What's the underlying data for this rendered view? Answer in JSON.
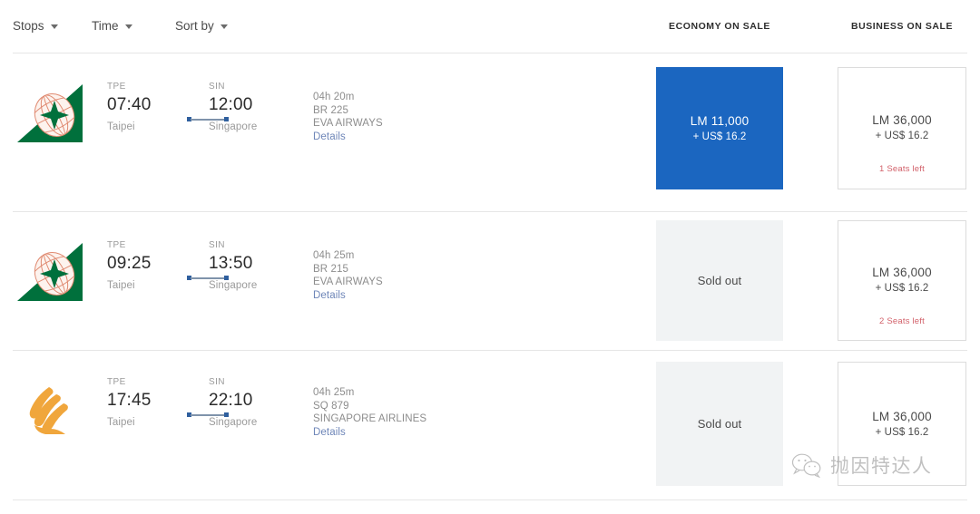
{
  "filters": [
    {
      "label": "Stops",
      "icon": "chevron-down-icon"
    },
    {
      "label": "Time",
      "icon": "chevron-down-icon"
    },
    {
      "label": "Sort by",
      "icon": "chevron-down-icon"
    }
  ],
  "columns": {
    "economy": "ECONOMY ON SALE",
    "business": "BUSINESS ON SALE"
  },
  "colors": {
    "selected_fare_bg": "#1b66c0",
    "soldout_bg": "#f1f3f4",
    "seats_left_text": "#d2616a",
    "details_link": "#6e86b8",
    "path_dot": "#2f5f9e",
    "eva_green": "#00703c",
    "eva_globe": "#e08b72",
    "sia_gold": "#f0a63c"
  },
  "flights": [
    {
      "logo": "eva-air-logo",
      "depart": {
        "airport": "TPE",
        "time": "07:40",
        "city": "Taipei"
      },
      "arrive": {
        "airport": "SIN",
        "time": "12:00",
        "city": "Singapore"
      },
      "duration": "04h 20m",
      "flight_number": "BR 225",
      "airline": "EVA AIRWAYS",
      "details_label": "Details",
      "economy": {
        "state": "selected",
        "price": "LM 11,000",
        "tax": "+ US$ 16.2",
        "seats_left": ""
      },
      "business": {
        "state": "available",
        "price": "LM 36,000",
        "tax": "+ US$ 16.2",
        "seats_left": "1 Seats left"
      }
    },
    {
      "logo": "eva-air-logo",
      "depart": {
        "airport": "TPE",
        "time": "09:25",
        "city": "Taipei"
      },
      "arrive": {
        "airport": "SIN",
        "time": "13:50",
        "city": "Singapore"
      },
      "duration": "04h 25m",
      "flight_number": "BR 215",
      "airline": "EVA AIRWAYS",
      "details_label": "Details",
      "economy": {
        "state": "soldout",
        "sold_out_label": "Sold out"
      },
      "business": {
        "state": "available",
        "price": "LM 36,000",
        "tax": "+ US$ 16.2",
        "seats_left": "2 Seats left"
      }
    },
    {
      "logo": "singapore-airlines-logo",
      "depart": {
        "airport": "TPE",
        "time": "17:45",
        "city": "Taipei"
      },
      "arrive": {
        "airport": "SIN",
        "time": "22:10",
        "city": "Singapore"
      },
      "duration": "04h 25m",
      "flight_number": "SQ 879",
      "airline": "SINGAPORE AIRLINES",
      "details_label": "Details",
      "economy": {
        "state": "soldout",
        "sold_out_label": "Sold out"
      },
      "business": {
        "state": "available",
        "price": "LM 36,000",
        "tax": "+ US$ 16.2",
        "seats_left": ""
      }
    }
  ],
  "watermark": {
    "icon": "wechat-icon",
    "text": "抛因特达人"
  }
}
